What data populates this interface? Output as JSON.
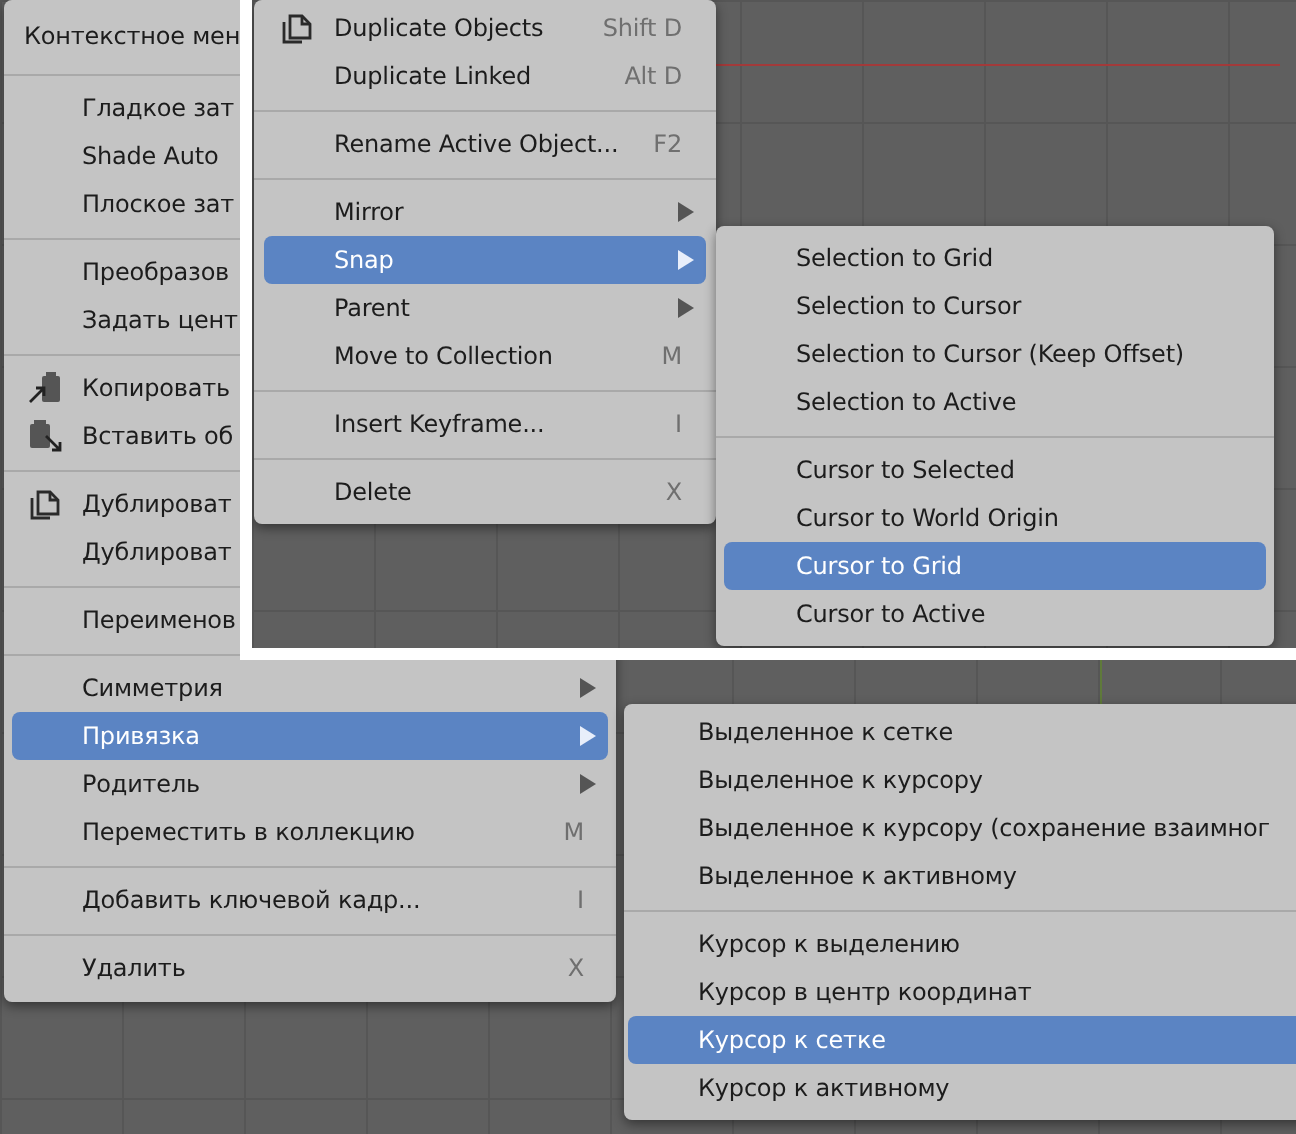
{
  "context_menu": {
    "title": "Контекстное мен",
    "sections": [
      [
        {
          "label": "Гладкое зат",
          "submenu": false,
          "selected": false
        },
        {
          "label": "Shade Auto",
          "submenu": false,
          "selected": false
        },
        {
          "label": "Плоское зат",
          "submenu": false,
          "selected": false
        }
      ],
      [
        {
          "label": "Преобразов",
          "submenu": false,
          "selected": false
        },
        {
          "label": "Задать цент",
          "submenu": false,
          "selected": false
        }
      ],
      [
        {
          "label": "Копировать",
          "kind": "copy",
          "submenu": false,
          "selected": false
        },
        {
          "label": "Вставить об",
          "kind": "paste",
          "submenu": false,
          "selected": false
        }
      ],
      [
        {
          "label": "Дублироват",
          "kind": "duplicate",
          "submenu": false,
          "selected": false
        },
        {
          "label": "Дублироват",
          "submenu": false,
          "selected": false
        }
      ],
      [
        {
          "label": "Переименов",
          "submenu": false,
          "selected": false
        }
      ],
      [
        {
          "label": "Симметрия",
          "submenu": true,
          "selected": false
        },
        {
          "label": "Привязка",
          "submenu": true,
          "selected": true
        },
        {
          "label": "Родитель",
          "submenu": true,
          "selected": false
        },
        {
          "label": "Переместить в коллекцию",
          "shortcut": "M",
          "submenu": false,
          "selected": false
        }
      ],
      [
        {
          "label": "Добавить ключевой кадр...",
          "shortcut": "I",
          "submenu": false,
          "selected": false
        }
      ],
      [
        {
          "label": "Удалить",
          "shortcut": "X",
          "submenu": false,
          "selected": false
        }
      ]
    ]
  },
  "snap_submenu": {
    "sections": [
      [
        {
          "label": "Выделенное к сетке",
          "selected": false
        },
        {
          "label": "Выделенное к курсору",
          "selected": false
        },
        {
          "label": "Выделенное к курсору (сохранение взаимног",
          "selected": false
        },
        {
          "label": "Выделенное к активному",
          "selected": false
        }
      ],
      [
        {
          "label": "Курсор к выделению",
          "selected": false
        },
        {
          "label": "Курсор в центр координат",
          "selected": false
        },
        {
          "label": "Курсор к сетке",
          "selected": true
        },
        {
          "label": "Курсор к активному",
          "selected": false
        }
      ]
    ]
  },
  "inset": {
    "context_menu": {
      "sections": [
        [
          {
            "label": "Duplicate Objects",
            "kind": "duplicate",
            "shortcut": "Shift D",
            "submenu": false,
            "selected": false
          },
          {
            "label": "Duplicate Linked",
            "shortcut": "Alt D",
            "submenu": false,
            "selected": false
          }
        ],
        [
          {
            "label": "Rename Active Object...",
            "shortcut": "F2",
            "submenu": false,
            "selected": false
          }
        ],
        [
          {
            "label": "Mirror",
            "submenu": true,
            "selected": false
          },
          {
            "label": "Snap",
            "submenu": true,
            "selected": true
          },
          {
            "label": "Parent",
            "submenu": true,
            "selected": false
          },
          {
            "label": "Move to Collection",
            "shortcut": "M",
            "submenu": false,
            "selected": false
          }
        ],
        [
          {
            "label": "Insert Keyframe...",
            "shortcut": "I",
            "submenu": false,
            "selected": false
          }
        ],
        [
          {
            "label": "Delete",
            "shortcut": "X",
            "submenu": false,
            "selected": false
          }
        ]
      ]
    },
    "snap_submenu": {
      "sections": [
        [
          {
            "label": "Selection to Grid",
            "selected": false
          },
          {
            "label": "Selection to Cursor",
            "selected": false
          },
          {
            "label": "Selection to Cursor (Keep Offset)",
            "selected": false
          },
          {
            "label": "Selection to Active",
            "selected": false
          }
        ],
        [
          {
            "label": "Cursor to Selected",
            "selected": false
          },
          {
            "label": "Cursor to World Origin",
            "selected": false
          },
          {
            "label": "Cursor to Grid",
            "selected": true
          },
          {
            "label": "Cursor to Active",
            "selected": false
          }
        ]
      ]
    }
  }
}
